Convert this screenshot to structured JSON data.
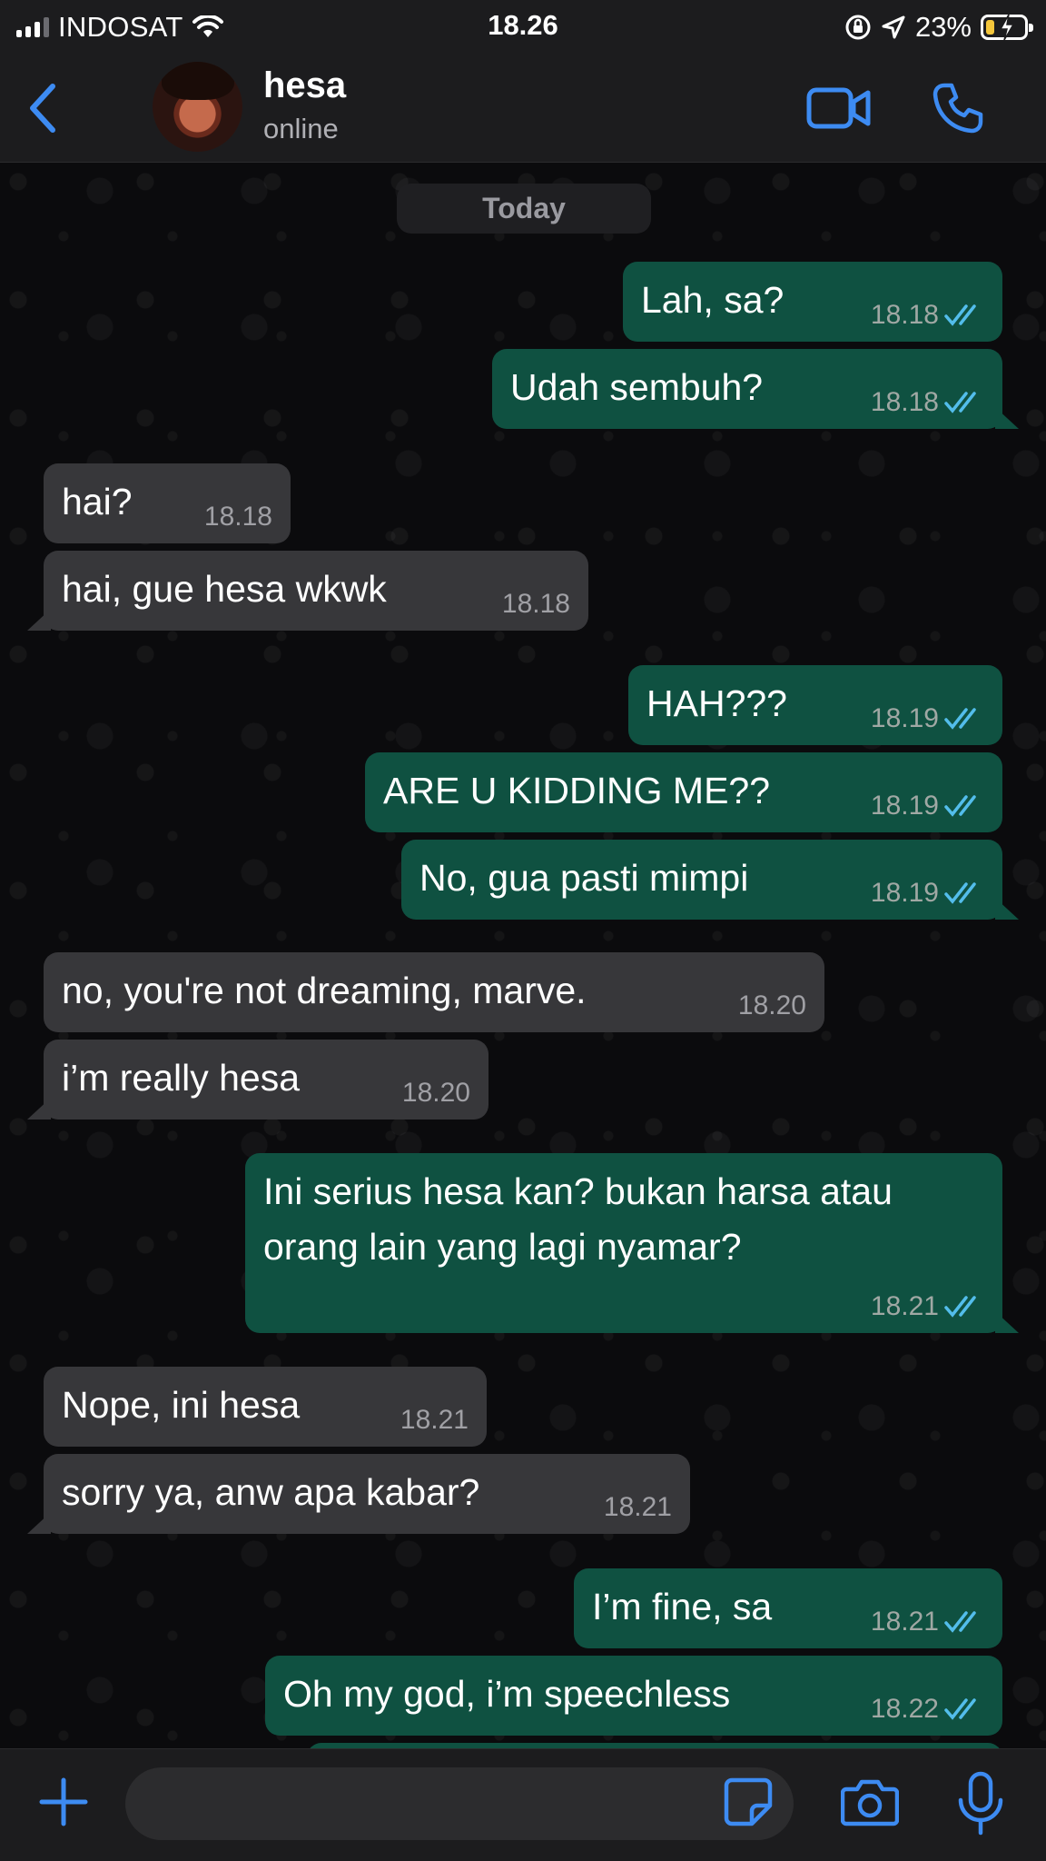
{
  "status_bar": {
    "carrier": "INDOSAT",
    "time": "18.26",
    "battery": "23%",
    "battery_level": 0.23
  },
  "header": {
    "name": "hesa",
    "status": "online"
  },
  "chat": {
    "day_label": "Today",
    "messages": [
      {
        "dir": "out",
        "text": "Lah, sa?",
        "time": "18.18"
      },
      {
        "dir": "out",
        "text": "Udah sembuh?",
        "time": "18.18"
      },
      {
        "dir": "in",
        "text": "hai?",
        "time": "18.18"
      },
      {
        "dir": "in",
        "text": "hai, gue hesa wkwk",
        "time": "18.18"
      },
      {
        "dir": "out",
        "text": "HAH???",
        "time": "18.19"
      },
      {
        "dir": "out",
        "text": "ARE U KIDDING ME??",
        "time": "18.19"
      },
      {
        "dir": "out",
        "text": "No, gua pasti mimpi",
        "time": "18.19"
      },
      {
        "dir": "in",
        "text": "no, you're not dreaming, marve.",
        "time": "18.20"
      },
      {
        "dir": "in",
        "text": "i’m really hesa",
        "time": "18.20"
      },
      {
        "dir": "out",
        "text": "Ini serius hesa kan? bukan harsa atau orang lain yang lagi nyamar?",
        "time": "18.21"
      },
      {
        "dir": "in",
        "text": "Nope, ini hesa",
        "time": "18.21"
      },
      {
        "dir": "in",
        "text": "sorry ya, anw apa kabar?",
        "time": "18.21"
      },
      {
        "dir": "out",
        "text": "I’m fine, sa",
        "time": "18.21"
      },
      {
        "dir": "out",
        "text": "Oh my god, i’m speechless",
        "time": "18.22"
      }
    ]
  },
  "input": {
    "placeholder": ""
  },
  "colors": {
    "accent": "#3d8bf2",
    "outgoing_bubble": "#0f5141",
    "incoming_bubble": "#37373a",
    "read_ticks": "#53bdeb"
  }
}
